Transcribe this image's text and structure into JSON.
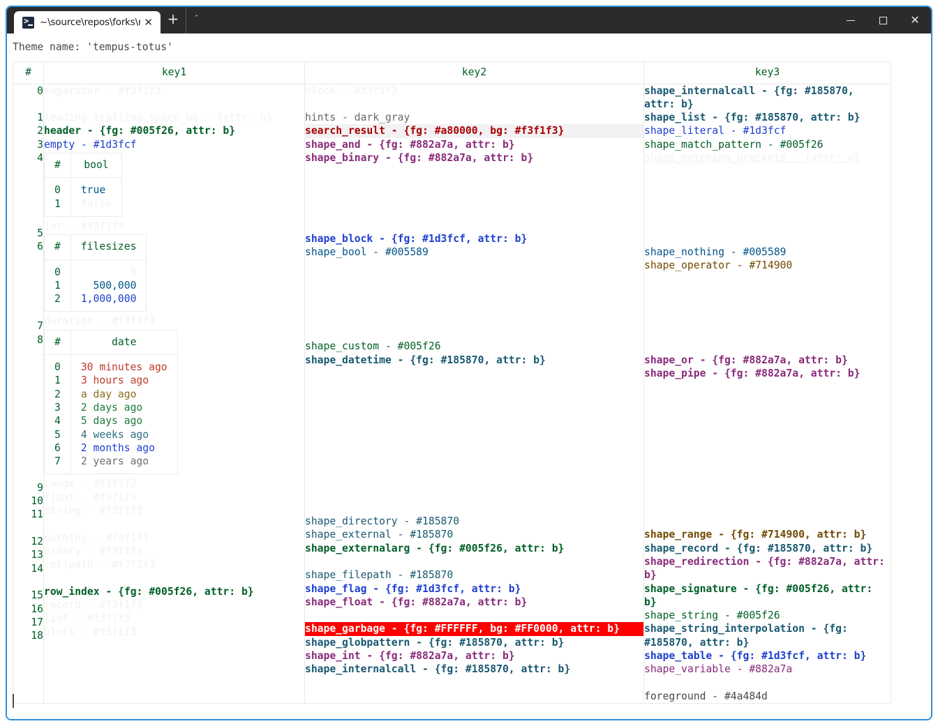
{
  "window": {
    "tab": {
      "icon": "powershell-icon",
      "title": "~\\source\\repos\\forks\\nu_scrip",
      "close": "✕"
    },
    "new_tab": "+",
    "tab_menu": "ˇ",
    "controls": {
      "minimize": "—",
      "maximize": "□",
      "close": "✕"
    }
  },
  "terminal": {
    "theme_line": "Theme name: 'tempus-totus'",
    "prompt": ""
  },
  "table": {
    "headers": {
      "index": "#",
      "key1": "key1",
      "key2": "key2",
      "key3": "key3"
    },
    "row_indices": [
      "0",
      "1",
      "2",
      "3",
      "4",
      "5",
      "6",
      "7",
      "8",
      "9",
      "10",
      "11",
      "12",
      "13",
      "14",
      "15",
      "16",
      "17",
      "18"
    ],
    "key1": [
      {
        "text": "separator - #f3f1f3",
        "style": "c-faint"
      },
      {
        "text": "",
        "style": "blank"
      },
      {
        "text": "leading_trailing_space_bg - {attr: n}",
        "style": "c-faint"
      },
      {
        "text": "header - {fg: #005f26, attr: b}",
        "style": "c-green"
      },
      {
        "text": "empty - #1d3fcf",
        "style": "c-blue"
      }
    ],
    "key1_bool_table": {
      "headers": [
        "#",
        "bool"
      ],
      "rows": [
        {
          "index": "0",
          "value": "true",
          "style": "c-cyan"
        },
        {
          "index": "1",
          "value": "false",
          "style": "c-faint"
        }
      ]
    },
    "key1_int_line": {
      "text": "int - #f3f1f3",
      "style": "c-faint"
    },
    "key1_filesizes_table": {
      "headers": [
        "#",
        "filesizes"
      ],
      "rows": [
        {
          "index": "0",
          "value": "0",
          "style": "c-faint"
        },
        {
          "index": "1",
          "value": "500,000",
          "style": "c-cyan"
        },
        {
          "index": "2",
          "value": "1,000,000",
          "style": "c-blue"
        }
      ]
    },
    "key1_duration_line": {
      "text": "duration - #f3f1f3",
      "style": "c-faint"
    },
    "key1_date_table": {
      "headers": [
        "#",
        "date"
      ],
      "rows": [
        {
          "index": "0",
          "value": "30 minutes ago",
          "style": "c-datered"
        },
        {
          "index": "1",
          "value": "3 hours ago",
          "style": "c-datered"
        },
        {
          "index": "2",
          "value": "a day ago",
          "style": "c-dateolive"
        },
        {
          "index": "3",
          "value": "2 days ago",
          "style": "c-dategreen"
        },
        {
          "index": "4",
          "value": "5 days ago",
          "style": "c-dategreen"
        },
        {
          "index": "5",
          "value": "4 weeks ago",
          "style": "c-dateteal"
        },
        {
          "index": "6",
          "value": "2 months ago",
          "style": "c-dateblue"
        },
        {
          "index": "7",
          "value": "2 years ago",
          "style": "c-dategray"
        }
      ]
    },
    "key1_tail": [
      {
        "text": "range - #f3f1f3",
        "style": "c-faint"
      },
      {
        "text": "float - #f3f1f3",
        "style": "c-faint"
      },
      {
        "text": "string - #f3f1f3",
        "style": "c-faint"
      },
      {
        "text": "",
        "style": "blank"
      },
      {
        "text": "nothing - #f3f1f3",
        "style": "c-faint"
      },
      {
        "text": "binary - #f3f1f3",
        "style": "c-faint"
      },
      {
        "text": "cellpath - #f3f1f3",
        "style": "c-faint"
      },
      {
        "text": "",
        "style": "blank"
      },
      {
        "text": "row_index - {fg: #005f26, attr: b}",
        "style": "c-green"
      },
      {
        "text": "record - #f3f1f3",
        "style": "c-faint"
      },
      {
        "text": "list - #f3f1f3",
        "style": "c-faint"
      },
      {
        "text": "block - #f3f1f3",
        "style": "c-faint"
      }
    ],
    "key2": [
      {
        "text": "block - #f3f1f3",
        "style": "c-faint"
      },
      {
        "text": "",
        "style": "blank"
      },
      {
        "text": "hints - dark_gray",
        "style": "c-darkgray"
      },
      {
        "text": "search_result - {fg: #a80000, bg: #f3f1f3}",
        "style": "c-red"
      },
      {
        "text": "shape_and - {fg: #882a7a, attr: b}",
        "style": "c-purple"
      },
      {
        "text": "shape_binary - {fg: #882a7a, attr: b}",
        "style": "c-purple"
      },
      {
        "text": "",
        "style": "blank"
      },
      {
        "text": "",
        "style": "blank"
      },
      {
        "text": "",
        "style": "blank"
      },
      {
        "text": "",
        "style": "blank"
      },
      {
        "text": "",
        "style": "blank"
      },
      {
        "text": "shape_block - {fg: #1d3fcf, attr: b}",
        "style": "c-blue-b"
      },
      {
        "text": "shape_bool - #005589",
        "style": "c-cyan"
      },
      {
        "text": "",
        "style": "blank"
      },
      {
        "text": "",
        "style": "blank"
      },
      {
        "text": "",
        "style": "blank"
      },
      {
        "text": "",
        "style": "blank"
      },
      {
        "text": "",
        "style": "blank"
      },
      {
        "text": "",
        "style": "blank"
      },
      {
        "text": "shape_custom - #005f26",
        "style": "c-greenplain"
      },
      {
        "text": "shape_datetime - {fg: #185870, attr: b}",
        "style": "c-teal"
      },
      {
        "text": "",
        "style": "blank"
      },
      {
        "text": "",
        "style": "blank"
      },
      {
        "text": "",
        "style": "blank"
      },
      {
        "text": "",
        "style": "blank"
      },
      {
        "text": "",
        "style": "blank"
      },
      {
        "text": "",
        "style": "blank"
      },
      {
        "text": "",
        "style": "blank"
      },
      {
        "text": "",
        "style": "blank"
      },
      {
        "text": "",
        "style": "blank"
      },
      {
        "text": "",
        "style": "blank"
      },
      {
        "text": "",
        "style": "blank"
      },
      {
        "text": "shape_directory - #185870",
        "style": "c-tealplain"
      },
      {
        "text": "shape_external - #185870",
        "style": "c-tealplain"
      },
      {
        "text": "shape_externalarg - {fg: #005f26, attr: b}",
        "style": "c-green"
      },
      {
        "text": "",
        "style": "blank"
      },
      {
        "text": "shape_filepath - #185870",
        "style": "c-tealplain"
      },
      {
        "text": "shape_flag - {fg: #1d3fcf, attr: b}",
        "style": "c-blue-b"
      },
      {
        "text": "shape_float - {fg: #882a7a, attr: b}",
        "style": "c-purple"
      },
      {
        "text": "",
        "style": "blank"
      },
      {
        "text": "shape_garbage - {fg: #FFFFFF, bg: #FF0000, attr: b}",
        "style": "c-garbage"
      },
      {
        "text": "shape_globpattern - {fg: #185870, attr: b}",
        "style": "c-teal"
      },
      {
        "text": "shape_int - {fg: #882a7a, attr: b}",
        "style": "c-purple"
      },
      {
        "text": "shape_internalcall - {fg: #185870, attr: b}",
        "style": "c-teal"
      }
    ],
    "key3": [
      {
        "text": "shape_internalcall - {fg: #185870, attr: b}",
        "style": "c-teal"
      },
      {
        "text": "shape_list - {fg: #185870, attr: b}",
        "style": "c-teal"
      },
      {
        "text": "shape_literal - #1d3fcf",
        "style": "c-blue"
      },
      {
        "text": "shape_match_pattern - #005f26",
        "style": "c-greenplain"
      },
      {
        "text": "shape_matching_brackets - {attr: u}",
        "style": "c-faint-u"
      },
      {
        "text": "",
        "style": "blank"
      },
      {
        "text": "",
        "style": "blank"
      },
      {
        "text": "",
        "style": "blank"
      },
      {
        "text": "",
        "style": "blank"
      },
      {
        "text": "",
        "style": "blank"
      },
      {
        "text": "",
        "style": "blank"
      },
      {
        "text": "shape_nothing - #005589",
        "style": "c-cyan"
      },
      {
        "text": "shape_operator - #714900",
        "style": "c-oliveplain"
      },
      {
        "text": "",
        "style": "blank"
      },
      {
        "text": "",
        "style": "blank"
      },
      {
        "text": "",
        "style": "blank"
      },
      {
        "text": "",
        "style": "blank"
      },
      {
        "text": "",
        "style": "blank"
      },
      {
        "text": "",
        "style": "blank"
      },
      {
        "text": "shape_or - {fg: #882a7a, attr: b}",
        "style": "c-purple"
      },
      {
        "text": "shape_pipe - {fg: #882a7a, attr: b}",
        "style": "c-purple"
      },
      {
        "text": "",
        "style": "blank"
      },
      {
        "text": "",
        "style": "blank"
      },
      {
        "text": "",
        "style": "blank"
      },
      {
        "text": "",
        "style": "blank"
      },
      {
        "text": "",
        "style": "blank"
      },
      {
        "text": "",
        "style": "blank"
      },
      {
        "text": "",
        "style": "blank"
      },
      {
        "text": "",
        "style": "blank"
      },
      {
        "text": "",
        "style": "blank"
      },
      {
        "text": "",
        "style": "blank"
      },
      {
        "text": "",
        "style": "blank"
      },
      {
        "text": "shape_range - {fg: #714900, attr: b}",
        "style": "c-olive"
      },
      {
        "text": "shape_record - {fg: #185870, attr: b}",
        "style": "c-teal"
      },
      {
        "text": "shape_redirection - {fg: #882a7a, attr: b}",
        "style": "c-purple"
      },
      {
        "text": "shape_signature - {fg: #005f26, attr: b}",
        "style": "c-green"
      },
      {
        "text": "shape_string - #005f26",
        "style": "c-greenplain"
      },
      {
        "text": "shape_string_interpolation - {fg: #185870, attr: b}",
        "style": "c-teal"
      },
      {
        "text": "shape_table - {fg: #1d3fcf, attr: b}",
        "style": "c-blue-b"
      },
      {
        "text": "shape_variable - #882a7a",
        "style": "c-purpleplain"
      },
      {
        "text": "",
        "style": "blank"
      },
      {
        "text": "foreground - #4a484d",
        "style": "c-gray"
      }
    ]
  }
}
